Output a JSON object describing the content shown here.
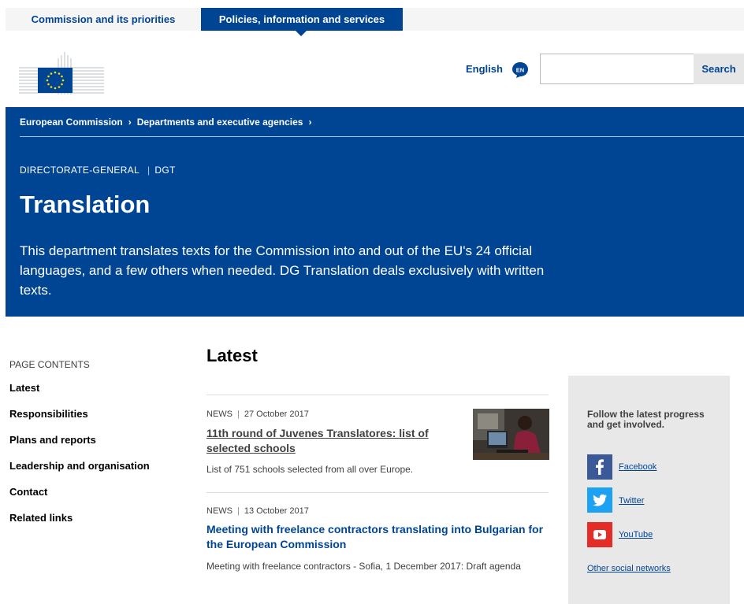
{
  "topnav": {
    "tab1": "Commission and its priorities",
    "tab2": "Policies, information and services"
  },
  "header": {
    "language": "English",
    "language_code": "EN",
    "search_placeholder": "",
    "search_button": "Search"
  },
  "banner": {
    "breadcrumb": [
      "European Commission",
      "Departments and executive agencies"
    ],
    "meta_type": "DIRECTORATE-GENERAL",
    "meta_code": "DGT",
    "title": "Translation",
    "intro": "This department translates texts for the Commission into and out of the EU's 24 official languages, and a few others when needed. DG Translation deals exclusively with written texts."
  },
  "page_contents": {
    "heading": "PAGE CONTENTS",
    "items": [
      "Latest",
      "Responsibilities",
      "Plans and reports",
      "Leadership and organisation",
      "Contact",
      "Related links"
    ]
  },
  "latest": {
    "heading": "Latest",
    "news": [
      {
        "type": "NEWS",
        "date": "27 October 2017",
        "title": "11th round of Juvenes Translatores: list of selected schools",
        "desc": "List of 751 schools selected from all over Europe."
      },
      {
        "type": "NEWS",
        "date": "13 October 2017",
        "title": "Meeting with freelance contractors translating into Bulgarian for the European Commission",
        "desc": "Meeting with freelance contractors - Sofia, 1 December 2017: Draft agenda"
      }
    ]
  },
  "social": {
    "heading": "Follow the latest progress and get involved.",
    "links": [
      {
        "label": "Facebook",
        "icon": "facebook-icon",
        "color": "#3b5998"
      },
      {
        "label": "Twitter",
        "icon": "twitter-icon",
        "color": "#1da1f2"
      },
      {
        "label": "YouTube",
        "icon": "youtube-icon",
        "color": "#e52d27"
      }
    ],
    "other": "Other social networks"
  },
  "colors": {
    "brand_blue": "#004494",
    "panel_gray": "#e8e8e8"
  }
}
